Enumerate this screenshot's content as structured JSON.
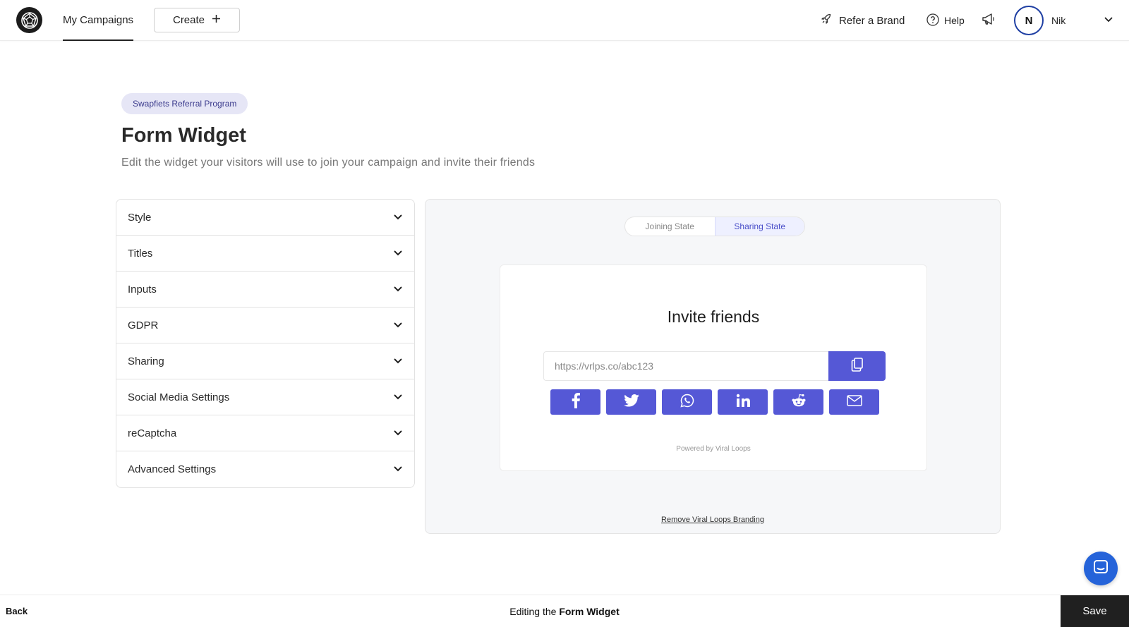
{
  "header": {
    "logo_icon": "viral-loops-logo-icon",
    "nav_tab": "My Campaigns",
    "create_label": "Create",
    "refer_label": "Refer a Brand",
    "help_label": "Help",
    "avatar_initial": "N",
    "username": "Nik"
  },
  "page": {
    "badge": "Swapfiets Referral Program",
    "title": "Form Widget",
    "subtitle": "Edit the widget your visitors will use to join your campaign and invite their friends"
  },
  "accordion": {
    "items": [
      {
        "label": "Style"
      },
      {
        "label": "Titles"
      },
      {
        "label": "Inputs"
      },
      {
        "label": "GDPR"
      },
      {
        "label": "Sharing"
      },
      {
        "label": "Social Media Settings"
      },
      {
        "label": "reCaptcha"
      },
      {
        "label": "Advanced Settings"
      }
    ]
  },
  "preview": {
    "states": [
      "Joining State",
      "Sharing State"
    ],
    "active_state": "Sharing State",
    "widget_title": "Invite friends",
    "referral_link": "https://vrlps.co/abc123",
    "share_icons": [
      "facebook-icon",
      "twitter-icon",
      "whatsapp-icon",
      "linkedin-icon",
      "reddit-icon",
      "email-icon"
    ],
    "powered_by": "Powered by Viral Loops",
    "remove_branding": "Remove Viral Loops Branding"
  },
  "footer": {
    "back_label": "Back",
    "editing_prefix": "Editing the",
    "editing_subject": "Form Widget",
    "save_label": "Save"
  },
  "colors": {
    "accent": "#5558d6",
    "badge_bg": "#e6e6f6",
    "chat": "#2563d9"
  }
}
